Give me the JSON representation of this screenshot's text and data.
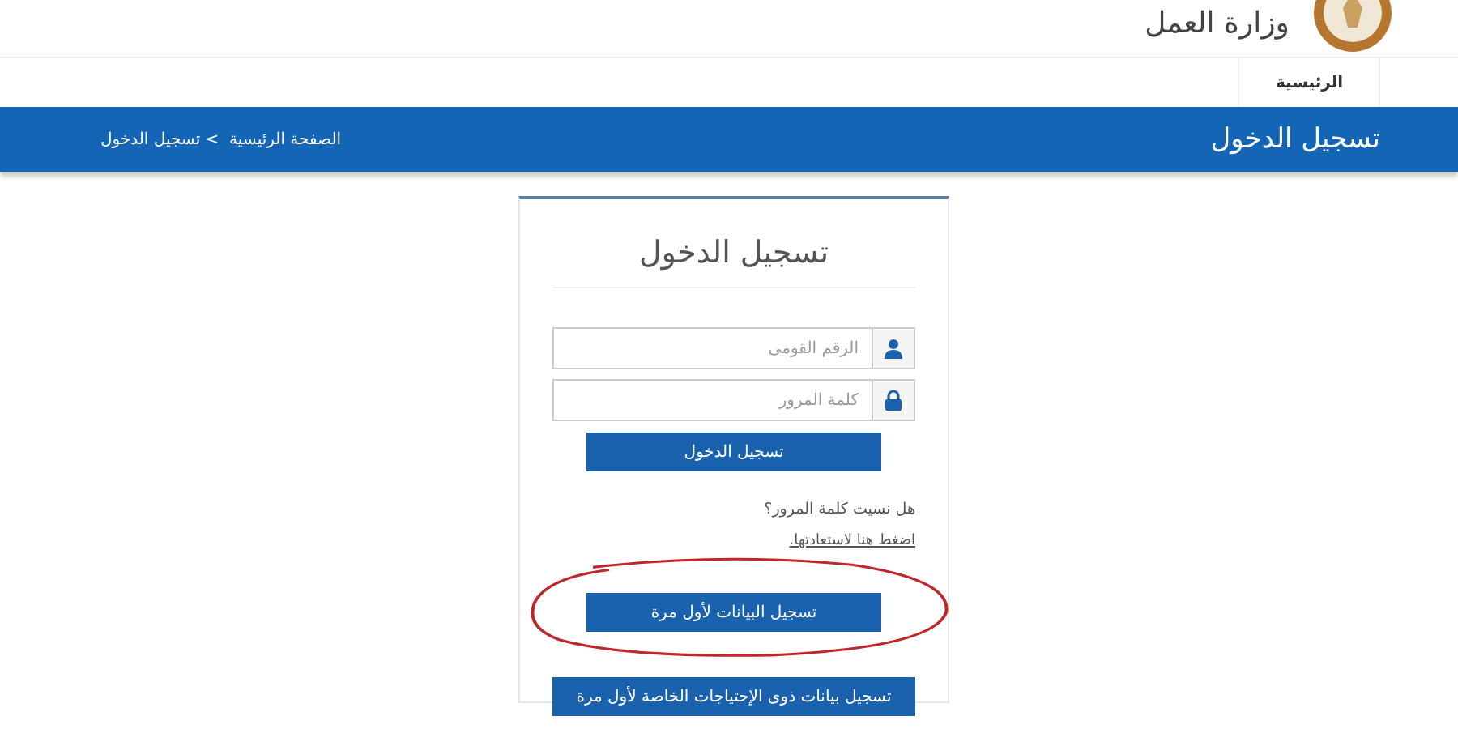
{
  "header": {
    "ministry": "وزارة العمل"
  },
  "nav": [
    {
      "label": "الرئيسية"
    }
  ],
  "page_bar": {
    "title": "تسجيل الدخول",
    "breadcrumb": "الصفحة الرئيسية  > تسجيل الدخول"
  },
  "login_form": {
    "title": "تسجيل الدخول",
    "fields": [
      {
        "kind": "user",
        "placeholder": "الرقم القومى"
      },
      {
        "kind": "password",
        "placeholder": "كلمة المرور"
      }
    ],
    "login_button": "تسجيل الدخول",
    "forgot_text": "هل نسيت كلمة المرور؟",
    "recover_link": "اضغط هنا لاستعادتها.",
    "register_button": "تسجيل البيانات لأول مرة",
    "special_register_button": "تسجيل بيانات ذوى الإحتياجات الخاصة لأول مرة"
  },
  "annotation": {
    "kind": "freehand-ellipse"
  }
}
